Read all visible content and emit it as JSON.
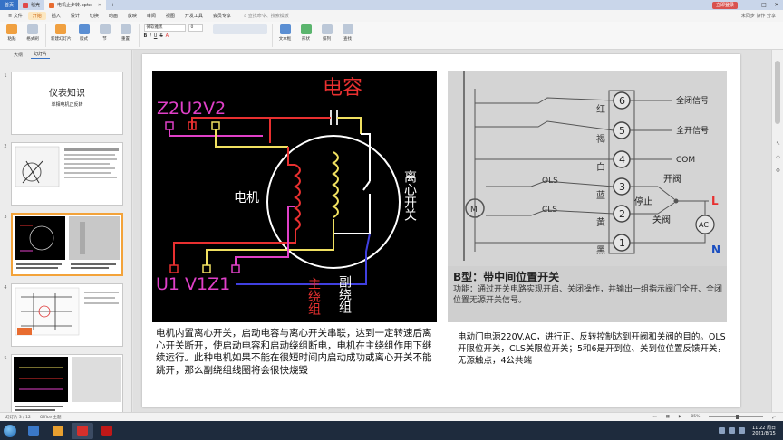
{
  "titlebar": {
    "tabs": [
      {
        "label": "首页",
        "kind": "home"
      },
      {
        "label": "稻壳",
        "kind": "normal"
      },
      {
        "label": "电机止步转.pptx",
        "kind": "active"
      }
    ],
    "add_tab": "+",
    "login": "立即登录"
  },
  "menubar": {
    "items": [
      "≡ 文件",
      "开始",
      "插入",
      "设计",
      "切换",
      "动画",
      "放映",
      "审阅",
      "视图",
      "开发工具",
      "会员专享"
    ],
    "search": "查找命令、搜索模板",
    "right": "未同步  协作  分享"
  },
  "ribbon": {
    "buttons": [
      "粘贴",
      "格式刷",
      "新建幻灯片",
      "版式",
      "节",
      "重置"
    ],
    "font_name": "微软雅黑",
    "font_size": "0",
    "format": [
      "B",
      "I",
      "U",
      "S",
      "A"
    ],
    "right_buttons": [
      "文本框",
      "形状",
      "排列",
      "查找"
    ]
  },
  "leftpanel": {
    "tabs": [
      "大纲",
      "幻灯片"
    ],
    "slide_numbers": [
      "1",
      "2",
      "3",
      "4",
      "5"
    ],
    "slide1_title": "仪表知识",
    "slide1_subtitle": "单相电机正反转",
    "add_slide": "+"
  },
  "slide": {
    "left_image": {
      "cap_label": "电容",
      "top_terminals": "Z2U2V2",
      "bottom_terminals": "U1 V1Z1",
      "motor_label": "电机",
      "switch_label": "离心开关",
      "main_winding": "主绕组",
      "aux_winding": "副绕组"
    },
    "right_image": {
      "terminals": [
        "6",
        "5",
        "4",
        "3",
        "2",
        "1"
      ],
      "colors": [
        "红",
        "褐",
        "白",
        "蓝",
        "黄",
        "黑"
      ],
      "signals": [
        "全闭信号",
        "全开信号",
        "COM"
      ],
      "labels": {
        "ols": "OLS",
        "cls": "CLS",
        "open": "开阀",
        "stop": "停止",
        "close": "关阀",
        "m": "M",
        "L": "L",
        "N": "N",
        "ac": "AC"
      },
      "caption_title": "B型：带中间位置开关",
      "caption_body": "功能：通过开关电路实现开启、关闭操作，并输出一组指示阀门全开、全闭位置无源开关信号。"
    },
    "left_text": "电机内置离心开关，启动电容与离心开关串联，达到一定转速后离心开关断开，使启动电容和启动绕组断电，电机在主绕组作用下继续运行。此种电机如果不能在很短时间内启动成功或离心开关不能跳开，那么副绕组线圈将会很快烧毁",
    "right_text": "电动门电源220V.AC，进行正、反转控制达到开阀和关阀的目的。OLS开限位开关，CLS关限位开关；5和6是开到位、关到位位置反馈开关，无源触点，4公共端"
  },
  "statusbar": {
    "slide_info": "幻灯片 3 / 12",
    "theme": "Office 主题",
    "zoom": "85%"
  },
  "taskbar": {
    "time": "11:22 周日",
    "date": "2021/8/15"
  },
  "colors": {
    "accent": "#3672c6",
    "selected_thumb": "#f3a33a",
    "circuit_red": "#e83030",
    "circuit_magenta": "#e040c8",
    "circuit_yellow": "#f0e060"
  }
}
